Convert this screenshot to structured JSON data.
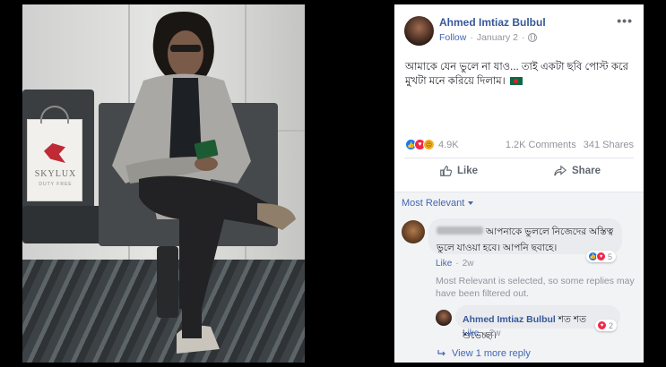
{
  "photo": {
    "bag_brand": "SKYLUX",
    "bag_sub": "DUTY FREE"
  },
  "post": {
    "author": "Ahmed Imtiaz Bulbul",
    "follow_label": "Follow",
    "date": "January 2",
    "separator": "·",
    "more_icon": "more-options-icon",
    "text": "আমাকে যেন ভুলে না যাও... তাই একটা ছবি পোস্ট করে মুখটা মনে করিয়ে দিলাম।"
  },
  "stats": {
    "reaction_count": "4.9K",
    "comments": "1.2K Comments",
    "shares": "341 Shares",
    "reaction_icons": [
      "like-reaction-icon",
      "love-reaction-icon",
      "sad-reaction-icon"
    ]
  },
  "actions": {
    "like_label": "Like",
    "share_label": "Share"
  },
  "filter": {
    "label": "Most Relevant"
  },
  "comments": [
    {
      "text": "আপনাকে ভুললে নিজেদের অস্তিত্ব ভুলে যাওয়া হবে। আপনি ছবাহে।",
      "like_label": "Like",
      "dot": "·",
      "time": "2w",
      "reaction_count": "5"
    }
  ],
  "filter_note": "Most Relevant is selected, so some replies may have been filtered out.",
  "reply": {
    "author": "Ahmed Imtiaz Bulbul",
    "text": "শত শত শুভেচ্ছা।",
    "like_label": "Like",
    "dot": "·",
    "time": "2w",
    "reaction_count": "2"
  },
  "view_more": "View 1 more reply",
  "colors": {
    "link_blue": "#4267b2",
    "name_blue": "#365899",
    "meta_gray": "#90949c",
    "like_blue": "#1877f2",
    "love_red": "#f0284a",
    "sad_yellow": "#f7b125"
  }
}
